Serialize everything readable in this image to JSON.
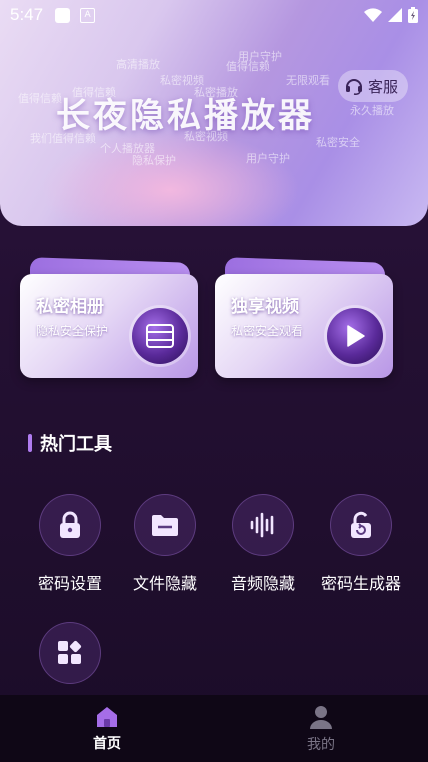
{
  "status_bar": {
    "time": "5:47"
  },
  "banner": {
    "title": "长夜隐私播放器",
    "service_label": "客服",
    "word_cloud": [
      "高清播放",
      "用户守护",
      "值得信赖",
      "私密视频",
      "无限观看",
      "值得信赖",
      "值得信赖",
      "私密播放",
      "永久播放",
      "我们值得信赖",
      "私密视频",
      "私密安全",
      "隐私保护",
      "用户守护",
      "个人播放器"
    ]
  },
  "cards": [
    {
      "title": "私密相册",
      "subtitle": "隐私安全保护",
      "icon": "album-icon"
    },
    {
      "title": "独享视频",
      "subtitle": "私密安全观看",
      "icon": "play-icon"
    }
  ],
  "hot_tools": {
    "title": "热门工具",
    "items": [
      {
        "label": "密码设置",
        "icon": "lock-icon"
      },
      {
        "label": "文件隐藏",
        "icon": "folder-icon"
      },
      {
        "label": "音频隐藏",
        "icon": "audio-wave-icon"
      },
      {
        "label": "密码生成器",
        "icon": "unlock-icon"
      },
      {
        "label": "",
        "icon": "apps-grid-icon"
      }
    ]
  },
  "tab_bar": {
    "tabs": [
      {
        "label": "首页",
        "active": true
      },
      {
        "label": "我的",
        "active": false
      }
    ]
  },
  "colors": {
    "accent": "#b07cf0",
    "background": "#241033",
    "tab_bar": "#0f0716",
    "inactive_tab": "#7a7486"
  }
}
